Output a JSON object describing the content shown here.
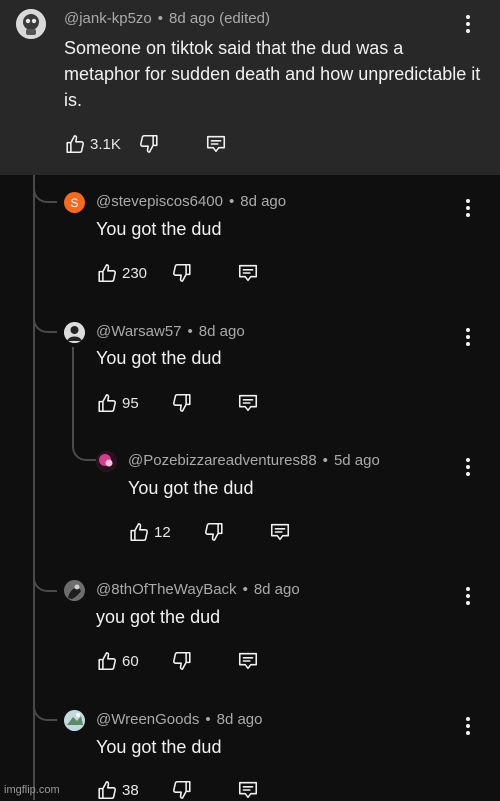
{
  "main_comment": {
    "author": "@jank-kp5zo",
    "time": "8d ago (edited)",
    "text": "Someone on tiktok said that the dud was a metaphor for sudden death and how unpredictable it is.",
    "likes": "3.1K"
  },
  "replies": [
    {
      "author": "@stevepiscos6400",
      "time": "8d ago",
      "text": "You got the dud",
      "likes": "230",
      "avatar_letter": "S",
      "avatar_color": "#f26b22"
    },
    {
      "author": "@Warsaw57",
      "time": "8d ago",
      "text": "You got the dud",
      "likes": "95"
    },
    {
      "author": "@Pozebizzareadventures88",
      "time": "5d ago",
      "text": "You got the dud",
      "likes": "12"
    },
    {
      "author": "@8thOfTheWayBack",
      "time": "8d ago",
      "text": "you got the dud",
      "likes": "60"
    },
    {
      "author": "@WreenGoods",
      "time": "8d ago",
      "text": "You got the dud",
      "likes": "38"
    }
  ],
  "separator": "•",
  "watermark": "imgflip.com",
  "icons": {
    "like": "thumbs-up-icon",
    "dislike": "thumbs-down-icon",
    "reply": "comment-icon",
    "more": "more-vert-icon"
  },
  "colors": {
    "top_background": "#282828",
    "background": "#0f0f0f",
    "meta_text": "#aaaaaa"
  }
}
